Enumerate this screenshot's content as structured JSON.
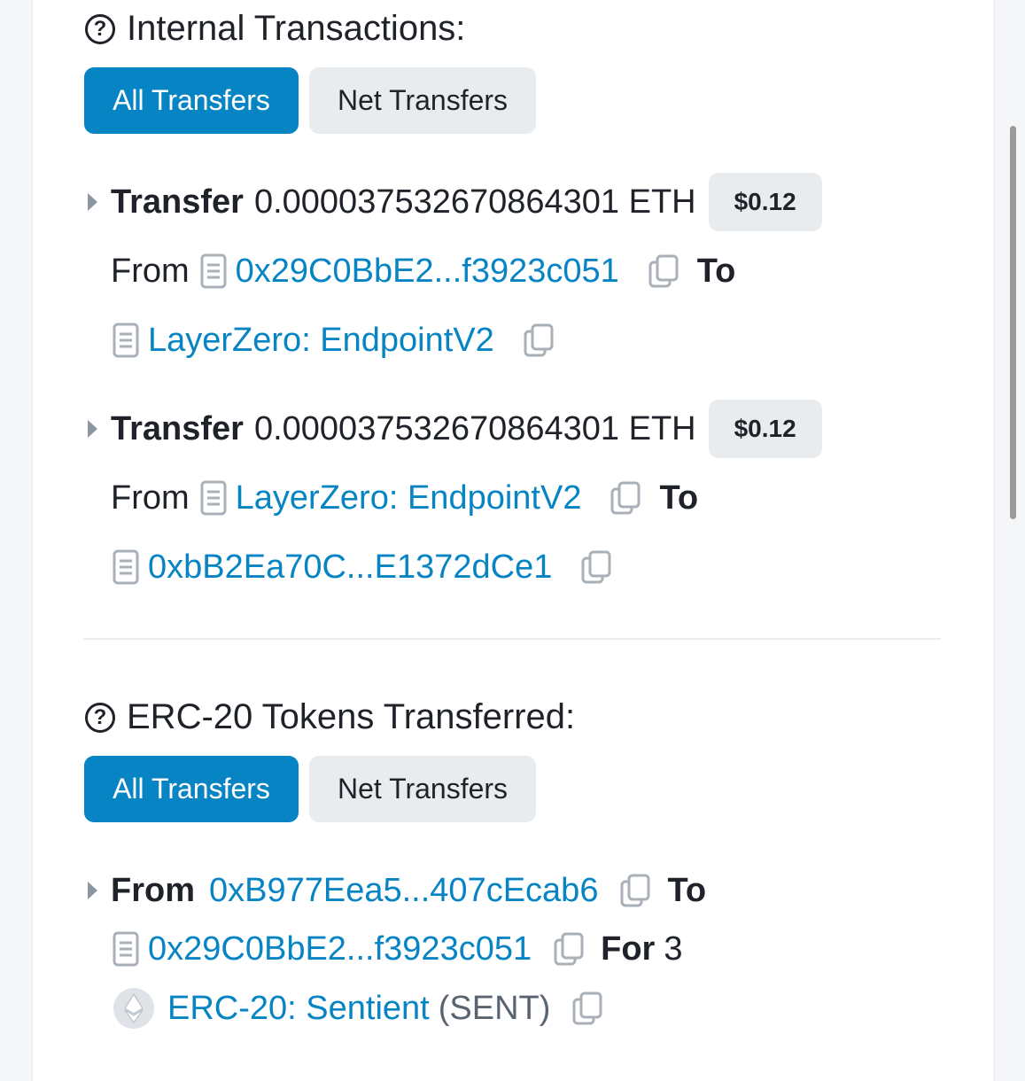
{
  "internal": {
    "title": "Internal Transactions:",
    "tabs": {
      "all": "All Transfers",
      "net": "Net Transfers"
    },
    "transfers": [
      {
        "label": "Transfer",
        "amount": "0.000037532670864301 ETH",
        "usd": "$0.12",
        "from_label": "From",
        "from": "0x29C0BbE2...f3923c051",
        "to_label": "To",
        "to": "LayerZero: EndpointV2"
      },
      {
        "label": "Transfer",
        "amount": "0.000037532670864301 ETH",
        "usd": "$0.12",
        "from_label": "From",
        "from": "LayerZero: EndpointV2",
        "to_label": "To",
        "to": "0xbB2Ea70C...E1372dCe1"
      }
    ]
  },
  "erc20": {
    "title": "ERC-20 Tokens Transferred:",
    "tabs": {
      "all": "All Transfers",
      "net": "Net Transfers"
    },
    "transfer": {
      "from_label": "From",
      "from": "0xB977Eea5...407cEcab6",
      "to_label": "To",
      "to": "0x29C0BbE2...f3923c051",
      "for_label": "For",
      "amount": "3",
      "token_name": "ERC-20: Sentient",
      "token_symbol": "(SENT)"
    }
  },
  "icons": {
    "help": "question-circle-icon",
    "expand": "caret-right-icon",
    "contract": "document-icon",
    "copy": "copy-icon",
    "token": "ethereum-icon"
  },
  "colors": {
    "accent": "#0784c3",
    "text": "#1f2329",
    "badge_bg": "#e9ecef",
    "icon_gray": "#a9b0b8"
  }
}
